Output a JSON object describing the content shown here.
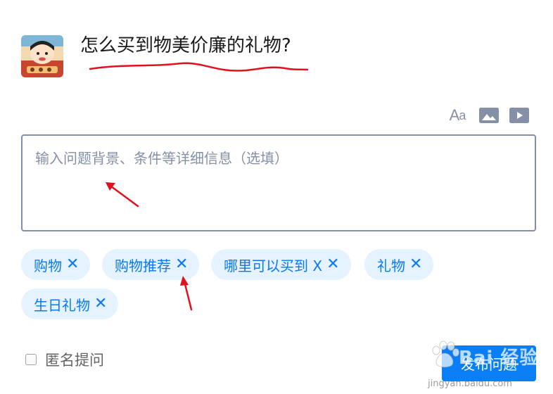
{
  "question": {
    "title": "怎么买到物美价廉的礼物?"
  },
  "toolbar": {
    "font_label_big": "A",
    "font_label_small": "a",
    "icons": [
      "font-size-icon",
      "image-icon",
      "video-icon"
    ]
  },
  "editor": {
    "placeholder": "输入问题背景、条件等详细信息（选填）"
  },
  "tags": [
    {
      "label": "购物",
      "remove": "✕"
    },
    {
      "label": "购物推荐",
      "remove": "✕"
    },
    {
      "label": "哪里可以买到 X",
      "remove": "✕"
    },
    {
      "label": "礼物",
      "remove": "✕"
    },
    {
      "label": "生日礼物",
      "remove": "✕"
    }
  ],
  "footer": {
    "anonymous_label": "匿名提问",
    "anonymous_checked": false,
    "publish_label": "发布问题"
  },
  "watermark": {
    "text": "Bai  经验",
    "sub": "jingyan.baidu.com"
  },
  "colors": {
    "accent": "#0a7ff5",
    "tag_bg": "#e5f2ff",
    "tag_text": "#0a78f0",
    "annotation": "#e0101e",
    "muted": "#8590a6"
  }
}
